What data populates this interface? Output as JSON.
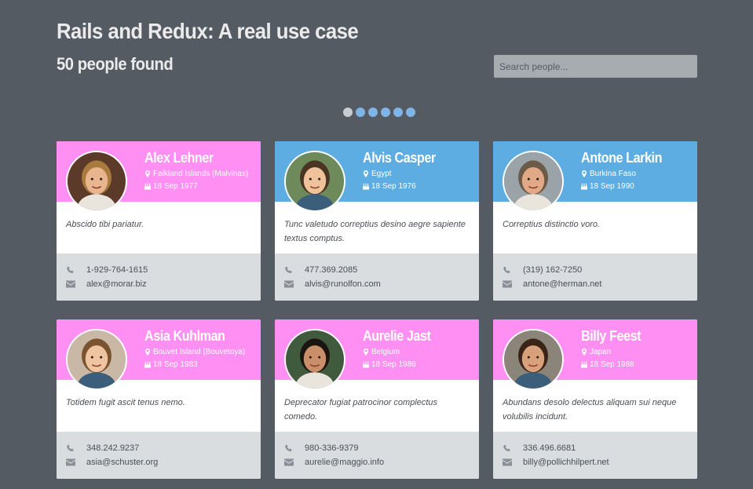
{
  "header": {
    "title": "Rails and Redux: A real use case",
    "count_text": "50 people found"
  },
  "search": {
    "placeholder": "Search people..."
  },
  "pagination": {
    "pages": 6,
    "active_index": 0
  },
  "colors": {
    "background": "#555b63",
    "pink": "#ff8ff3",
    "blue": "#5dade2",
    "footer": "#d9dde0"
  },
  "people": [
    {
      "name": "Alex Lehner",
      "location": "Falkland Islands (Malvinas)",
      "birth_date": "18 Sep 1977",
      "bio": "Abscido tibi pariatur.",
      "phone": "1-929-764-1615",
      "email": "alex@morar.biz",
      "header_color": "pink"
    },
    {
      "name": "Alvis Casper",
      "location": "Egypt",
      "birth_date": "18 Sep 1976",
      "bio": "Tunc valetudo correptius desino aegre sapiente textus comptus.",
      "phone": "477.369.2085",
      "email": "alvis@runolfon.com",
      "header_color": "blue"
    },
    {
      "name": "Antone Larkin",
      "location": "Burkina Faso",
      "birth_date": "18 Sep 1990",
      "bio": "Correptius distinctio voro.",
      "phone": "(319) 162-7250",
      "email": "antone@herman.net",
      "header_color": "blue"
    },
    {
      "name": "Asia Kuhlman",
      "location": "Bouvet Island (Bouvetoya)",
      "birth_date": "18 Sep 1983",
      "bio": "Totidem fugit ascit tenus nemo.",
      "phone": "348.242.9237",
      "email": "asia@schuster.org",
      "header_color": "pink"
    },
    {
      "name": "Aurelie Jast",
      "location": "Belgium",
      "birth_date": "18 Sep 1986",
      "bio": "Deprecator fugiat patrocinor complectus comedo.",
      "phone": "980-336-9379",
      "email": "aurelie@maggio.info",
      "header_color": "pink"
    },
    {
      "name": "Billy Feest",
      "location": "Japan",
      "birth_date": "18 Sep 1988",
      "bio": "Abundans desolo delectus aliquam sui neque volubilis incidunt.",
      "phone": "336.496.6681",
      "email": "billy@pollichhilpert.net",
      "header_color": "pink"
    }
  ]
}
